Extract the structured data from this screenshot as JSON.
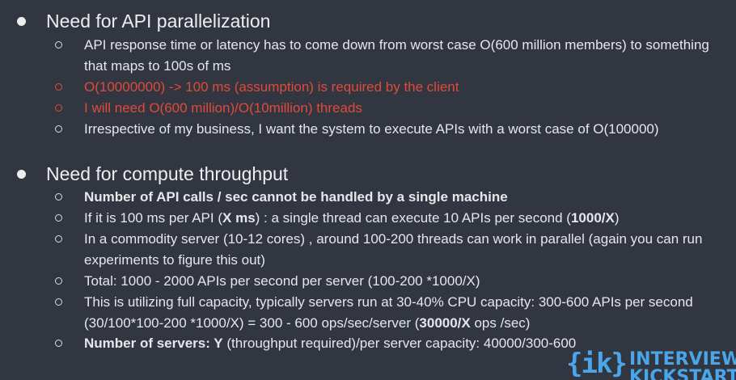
{
  "sections": [
    {
      "heading": "Need for API parallelization",
      "items": [
        {
          "text": "API response time or latency has to come  down from worst case O(600 million members) to something that maps to 100s of ms"
        },
        {
          "text": "O(10000000) -> 100 ms (assumption) is required by the client",
          "color": "#e04a3a"
        },
        {
          "text": "I will need O(600 million)/O(10million) threads",
          "color": "#e04a3a"
        },
        {
          "text": "Irrespective of my business, I want the system to execute APIs with a worst case of O(100000)"
        }
      ]
    },
    {
      "heading": "Need for compute throughput",
      "items": [
        {
          "bold": "Number of API calls / sec cannot be handled by a single machine"
        },
        {
          "a": "If it is 100 ms per API (",
          "b": "X ms",
          "c": ") : a single thread can execute 10 APIs per second (",
          "d": "1000/X",
          "e": ")"
        },
        {
          "text": "In a commodity server (10-12 cores) , around 100-200 threads can work in parallel (again you can run experiments to figure this out)"
        },
        {
          "text": "Total: 1000 - 2000 APIs per second per server (100-200 *1000/X)"
        },
        {
          "a": "This is utilizing full capacity, typically servers run at 30-40% CPU capacity: 300-600 APIs per second (30/100*100-200 *1000/X) = 300 - 600 ops/sec/server (",
          "b": "30000/X",
          "c": " ops /sec)"
        },
        {
          "a": "Number of servers",
          "b": ": Y",
          "c": " (throughput required)/per server capacity: 40000/300-600"
        }
      ]
    }
  ],
  "logo": {
    "mark": "{ik}",
    "line1": "INTERVIEW",
    "line2": "KICKSTART",
    "color": "#4aa6e8"
  },
  "colors": {
    "background": "#323640",
    "text": "#e6e7ea",
    "highlight_red": "#e04a3a"
  }
}
